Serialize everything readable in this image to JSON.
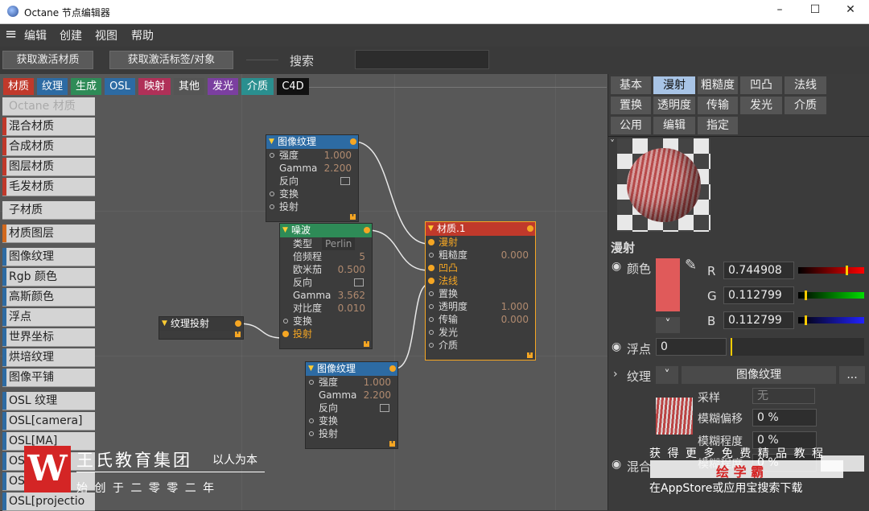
{
  "window": {
    "title": "Octane 节点编辑器",
    "minimize": "–",
    "maximize": "☐",
    "close": "✕"
  },
  "menu": {
    "hamburger": "≡",
    "items": [
      "编辑",
      "创建",
      "视图",
      "帮助"
    ]
  },
  "toolbar": {
    "get_material": "获取激活材质",
    "get_tag": "获取激活标签/对象",
    "search_label": "搜索",
    "search_value": ""
  },
  "category_tabs": [
    {
      "label": "材质",
      "color": "#c0392b"
    },
    {
      "label": "纹理",
      "color": "#2d6ba3"
    },
    {
      "label": "生成",
      "color": "#2e8b57"
    },
    {
      "label": "OSL",
      "color": "#2d6ba3"
    },
    {
      "label": "映射",
      "color": "#b03058"
    },
    {
      "label": "其他",
      "color": "#555555"
    },
    {
      "label": "发光",
      "color": "#7b3fa0"
    },
    {
      "label": "介质",
      "color": "#2a8f8f"
    },
    {
      "label": "C4D",
      "color": "#111111"
    }
  ],
  "node_list": [
    {
      "label": "Octane 材质",
      "stripe": "",
      "dim": true
    },
    {
      "label": "混合材质",
      "stripe": "#c0392b"
    },
    {
      "label": "合成材质",
      "stripe": "#c0392b"
    },
    {
      "label": "图层材质",
      "stripe": "#c0392b"
    },
    {
      "label": "毛发材质",
      "stripe": "#c0392b"
    },
    {
      "label": "子材质",
      "stripe": ""
    },
    {
      "label": "材质图层",
      "stripe": "#d2691e"
    },
    {
      "label": "图像纹理",
      "stripe": "#2d6ba3"
    },
    {
      "label": "Rgb 颜色",
      "stripe": "#2d6ba3"
    },
    {
      "label": "高斯颜色",
      "stripe": "#2d6ba3"
    },
    {
      "label": "浮点",
      "stripe": "#2d6ba3"
    },
    {
      "label": "世界坐标",
      "stripe": "#2d6ba3"
    },
    {
      "label": "烘培纹理",
      "stripe": "#2d6ba3"
    },
    {
      "label": "图像平铺",
      "stripe": "#2d6ba3"
    },
    {
      "label": "OSL 纹理",
      "stripe": "#2d6ba3"
    },
    {
      "label": "OSL[camera]",
      "stripe": "#2d6ba3"
    },
    {
      "label": "OSL[MA]",
      "stripe": "#2d6ba3"
    },
    {
      "label": "OSL[...]",
      "stripe": "#2d6ba3"
    },
    {
      "label": "OSL[...]",
      "stripe": "#2d6ba3"
    },
    {
      "label": "OSL[projectio",
      "stripe": "#2d6ba3"
    }
  ],
  "nodes": {
    "img1": {
      "title": "图像纹理",
      "rows": [
        {
          "label": "强度",
          "value": "1.000"
        },
        {
          "label": "Gamma",
          "value": "2.200"
        },
        {
          "label": "反向",
          "value": ""
        },
        {
          "label": "变换",
          "value": ""
        },
        {
          "label": "投射",
          "value": ""
        }
      ]
    },
    "noise": {
      "title": "噪波",
      "rows": [
        {
          "label": "类型",
          "value": "Perlin"
        },
        {
          "label": "倍频程",
          "value": "5"
        },
        {
          "label": "欧米茄",
          "value": "0.500"
        },
        {
          "label": "反向",
          "value": ""
        },
        {
          "label": "Gamma",
          "value": "3.562"
        },
        {
          "label": "对比度",
          "value": "0.010"
        },
        {
          "label": "变换",
          "value": ""
        },
        {
          "label": "投射",
          "value": ""
        }
      ]
    },
    "proj": {
      "title": "纹理投射"
    },
    "img2": {
      "title": "图像纹理",
      "rows": [
        {
          "label": "强度",
          "value": "1.000"
        },
        {
          "label": "Gamma",
          "value": "2.200"
        },
        {
          "label": "反向",
          "value": ""
        },
        {
          "label": "变换",
          "value": ""
        },
        {
          "label": "投射",
          "value": ""
        }
      ]
    },
    "mat": {
      "title": "材质.1",
      "rows": [
        {
          "label": "漫射",
          "value": ""
        },
        {
          "label": "粗糙度",
          "value": "0.000"
        },
        {
          "label": "凹凸",
          "value": ""
        },
        {
          "label": "法线",
          "value": ""
        },
        {
          "label": "置换",
          "value": ""
        },
        {
          "label": "透明度",
          "value": "1.000"
        },
        {
          "label": "传输",
          "value": "0.000"
        },
        {
          "label": "发光",
          "value": ""
        },
        {
          "label": "介质",
          "value": ""
        }
      ]
    }
  },
  "prop_tabs": [
    [
      "基本",
      "漫射",
      "粗糙度",
      "凹凸",
      "法线"
    ],
    [
      "置换",
      "透明度",
      "传输",
      "发光",
      "介质"
    ],
    [
      "公用",
      "编辑",
      "指定"
    ]
  ],
  "props": {
    "collapse": "˅",
    "section": "漫射",
    "color_label": "颜色",
    "color_hex": "#e05a5a",
    "dropdown": "˅",
    "r_label": "R",
    "r_value": "0.744908",
    "g_label": "G",
    "g_value": "0.112799",
    "b_label": "B",
    "b_value": "0.112799",
    "float_label": "浮点",
    "float_value": "0",
    "texture_label": "纹理",
    "texture_value": "图像纹理",
    "more": "...",
    "sampling_label": "采样",
    "sampling_value": "无",
    "blur_offset_label": "模糊偏移",
    "blur_offset_value": "0 %",
    "blur_degree_label": "模糊程度",
    "blur_degree_value": "0 %",
    "mix_label": "混合",
    "mix_value": "0 %",
    "mix_inner_label": "模糊程度"
  },
  "watermark": {
    "logo_letter": "W",
    "company": "王氏教育集团",
    "slogan": "以人为本",
    "founded": "始 创 于 二 零 零 二 年",
    "line1": "获 得 更 多 免 费 精 品 教 程",
    "brand": "绘 学 霸",
    "line3": "在AppStore或应用宝搜索下载"
  }
}
